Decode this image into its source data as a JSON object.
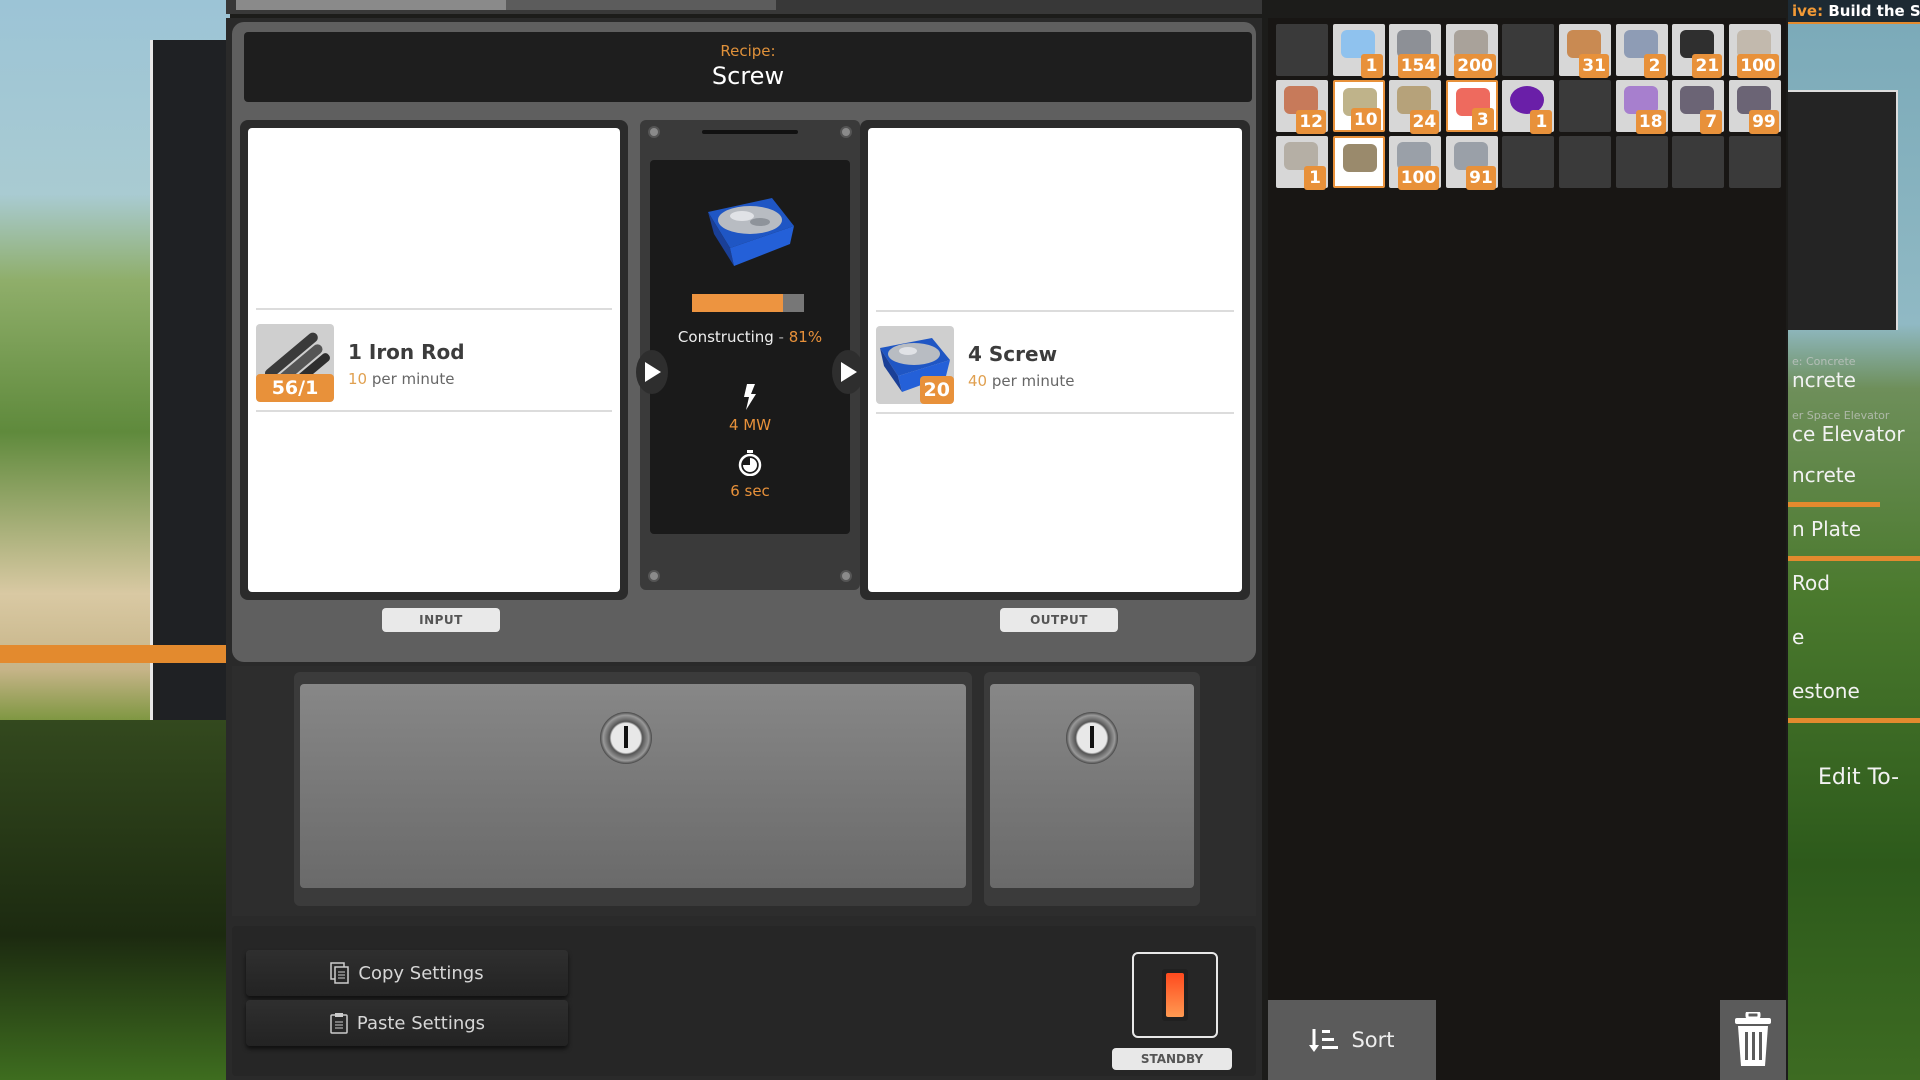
{
  "recipe": {
    "label": "Recipe:",
    "name": "Screw"
  },
  "input": {
    "tag": "INPUT",
    "item": {
      "icon": "iron-rod-icon",
      "quantity_name": "1 Iron Rod",
      "rate_value": "10",
      "rate_unit": "per minute",
      "stock": "56/1"
    }
  },
  "process": {
    "status_label": "Constructing",
    "status_separator": " - ",
    "progress_text": "81%",
    "progress": 0.81,
    "power": "4 MW",
    "cycle_time": "6 sec"
  },
  "output": {
    "tag": "OUTPUT",
    "item": {
      "icon": "screw-icon",
      "quantity_name": "4 Screw",
      "rate_value": "40",
      "rate_unit": "per minute",
      "stock": "20"
    }
  },
  "controls": {
    "copy_settings": "Copy Settings",
    "paste_settings": "Paste Settings",
    "power_state": "STANDBY"
  },
  "inventory": {
    "slots": [
      {
        "item": "",
        "count": ""
      },
      {
        "item": "quartz-crystal",
        "count": "1"
      },
      {
        "item": "iron-plate",
        "count": "154"
      },
      {
        "item": "concrete",
        "count": "200"
      },
      {
        "item": "",
        "count": ""
      },
      {
        "item": "wire",
        "count": "31"
      },
      {
        "item": "reinforced-iron-plate",
        "count": "2"
      },
      {
        "item": "cable",
        "count": "21"
      },
      {
        "item": "limestone",
        "count": "100"
      },
      {
        "item": "copper-ore",
        "count": "12"
      },
      {
        "item": "mercer-sphere-shell",
        "count": "10",
        "highlight": true
      },
      {
        "item": "copper-sheet",
        "count": "24"
      },
      {
        "item": "paleberry",
        "count": "3",
        "highlight": true
      },
      {
        "item": "mercer-sphere",
        "count": "1"
      },
      {
        "item": "",
        "count": ""
      },
      {
        "item": "s-am-ore",
        "count": "18"
      },
      {
        "item": "iron-ore",
        "count": "7"
      },
      {
        "item": "iron-ore-2",
        "count": "99"
      },
      {
        "item": "stone",
        "count": "1"
      },
      {
        "item": "xeno-zapper",
        "count": "",
        "highlight": true
      },
      {
        "item": "iron-ingot",
        "count": "100"
      },
      {
        "item": "iron-ingot-2",
        "count": "91"
      },
      {
        "item": "",
        "count": ""
      },
      {
        "item": "",
        "count": ""
      },
      {
        "item": "",
        "count": ""
      },
      {
        "item": "",
        "count": ""
      },
      {
        "item": "",
        "count": ""
      }
    ],
    "sort_label": "Sort"
  },
  "hud": {
    "objective_label": "ive:",
    "objective_text": "Build the Sp",
    "todo": [
      {
        "sub": "e: Concrete",
        "label": "ncrete",
        "progress": null
      },
      {
        "sub": "er Space Elevator",
        "label": "ce Elevator",
        "progress": null
      },
      {
        "sub": "",
        "label": "ncrete",
        "progress": 0.7
      },
      {
        "sub": "",
        "label": "n Plate",
        "progress": 1.0
      },
      {
        "sub": "",
        "label": "Rod",
        "progress": 0.0
      },
      {
        "sub": "",
        "label": "e",
        "progress": 0.0
      },
      {
        "sub": "",
        "label": "estone",
        "progress": 1.0
      }
    ],
    "edit_todo": "Edit To-"
  },
  "colors": {
    "accent": "#e8913a",
    "panel_dark": "#1e1e1e",
    "standby_light": "#ff5a28"
  }
}
